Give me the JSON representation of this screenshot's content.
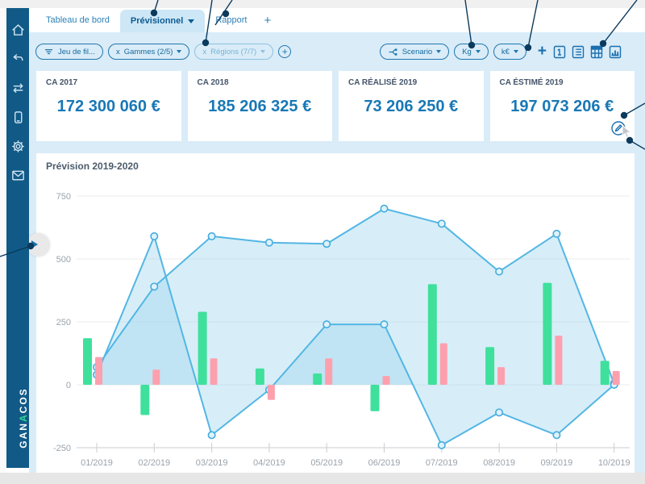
{
  "brand": {
    "name": "GANACOS",
    "accent_letter_index": 3,
    "accent_color": "#35d29a"
  },
  "sidebar": {
    "icons": [
      "home",
      "undo",
      "transfer",
      "device",
      "settings",
      "mail"
    ]
  },
  "tabs": [
    {
      "label": "Tableau de bord"
    },
    {
      "label": "Prévisionnel",
      "active": true,
      "has_caret": true
    },
    {
      "label": "Rapport"
    },
    {
      "label": "+"
    }
  ],
  "filter_bar": {
    "dataset_filter": {
      "label": "Jeu de fil..."
    },
    "gammes_filter": {
      "clear": "x",
      "label": "Gammes (2/5)"
    },
    "regions_filter": {
      "clear": "x",
      "label": "Régions (7/7)"
    },
    "add_filter_label": "+",
    "scenario": {
      "label": "Scenario"
    },
    "unit_kg": {
      "label": "Kg"
    },
    "unit_keur": {
      "label": "k€"
    },
    "add_widget_label": "+",
    "widget_icons": [
      "kpi-number",
      "list",
      "table",
      "bar-chart"
    ]
  },
  "kpi_cards": [
    {
      "label": "CA 2017",
      "value": "172 300 060 €"
    },
    {
      "label": "CA 2018",
      "value": "185 206 325 €"
    },
    {
      "label": "CA RÉALISÉ 2019",
      "value": "73 206 250 €"
    },
    {
      "label": "CA ÉSTIMÉ 2019",
      "value": "197 073 206 €",
      "has_edit_icon": true
    }
  ],
  "chart_data": {
    "type": "mixed-line-area-bar",
    "title": "Prévision 2019-2020",
    "categories": [
      "01/2019",
      "02/2019",
      "03/2019",
      "04/2019",
      "05/2019",
      "06/2019",
      "07/2019",
      "08/2019",
      "09/2019",
      "10/2019"
    ],
    "series": [
      {
        "name": "prevision-haute",
        "type": "area-line",
        "color": "#53b6e4",
        "values": [
          70,
          390,
          590,
          565,
          560,
          700,
          640,
          450,
          600,
          5
        ]
      },
      {
        "name": "prevision-basse",
        "type": "area-line",
        "color": "#53b6e4",
        "values": [
          40,
          590,
          -200,
          -20,
          240,
          240,
          -240,
          -110,
          -200,
          0
        ]
      },
      {
        "name": "barres-vertes",
        "type": "bar",
        "color": "#3fe09c",
        "values": [
          185,
          -120,
          290,
          65,
          45,
          -105,
          400,
          150,
          405,
          95
        ]
      },
      {
        "name": "barres-roses",
        "type": "bar",
        "color": "#fda0ae",
        "values": [
          110,
          60,
          105,
          -60,
          105,
          35,
          165,
          70,
          195,
          55
        ]
      }
    ],
    "yticks": [
      750,
      500,
      250,
      0,
      -250
    ],
    "ylim": [
      -250,
      800
    ],
    "grid": true,
    "legend": "none"
  },
  "annotations": {
    "color": "#0b3a5c",
    "callouts": [
      {
        "target": "previsionnel-caret",
        "line": [
          [
            196,
            0
          ],
          [
            191,
            16
          ]
        ]
      },
      {
        "target": "add-tab",
        "line": [
          [
            288,
            0
          ],
          [
            267,
            31
          ]
        ],
        "dot": [
          280,
          17
        ]
      },
      {
        "target": "regions-filter",
        "line": [
          [
            263,
            0
          ],
          [
            255,
            53
          ]
        ]
      },
      {
        "target": "scenario-button",
        "line": [
          [
            577,
            0
          ],
          [
            585,
            56
          ]
        ]
      },
      {
        "target": "unit-toggles",
        "line": [
          [
            667,
            0
          ],
          [
            655,
            59
          ]
        ]
      },
      {
        "target": "widget-icons",
        "line": [
          [
            790,
            0
          ],
          [
            748,
            54
          ]
        ]
      },
      {
        "target": "edit-icon",
        "line": [
          [
            800,
            128
          ],
          [
            774,
            143
          ]
        ]
      },
      {
        "target": "mouse-cursor",
        "line": [
          [
            800,
            185
          ],
          [
            781,
            174
          ]
        ]
      },
      {
        "target": "collapse-handle",
        "line": [
          [
            0,
            318
          ],
          [
            38,
            305
          ]
        ]
      }
    ]
  }
}
